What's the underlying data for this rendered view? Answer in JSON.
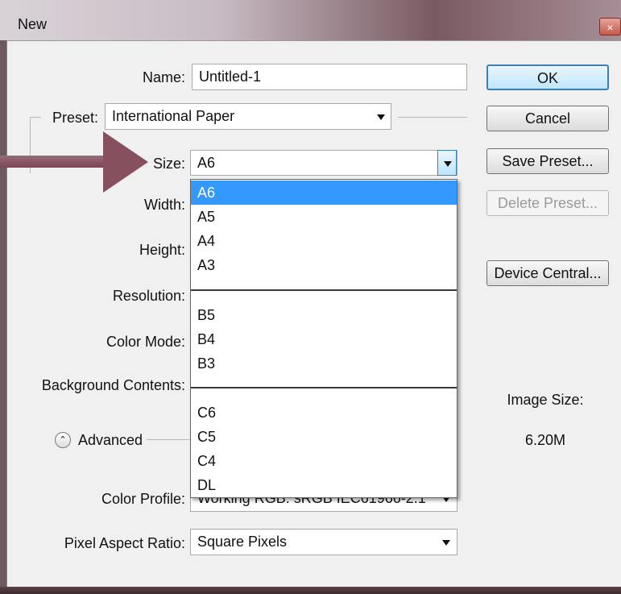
{
  "window": {
    "title": "New",
    "close_glyph": "×"
  },
  "form": {
    "name_label": "Name:",
    "name_value": "Untitled-1",
    "preset_label": "Preset:",
    "preset_value": "International Paper",
    "size_label": "Size:",
    "size_value": "A6",
    "width_label": "Width:",
    "height_label": "Height:",
    "resolution_label": "Resolution:",
    "color_mode_label": "Color Mode:",
    "background_label": "Background Contents:",
    "advanced_label": "Advanced",
    "color_profile_label": "Color Profile:",
    "color_profile_value": "Working RGB:  sRGB IEC61966-2.1",
    "pixel_aspect_label": "Pixel Aspect Ratio:",
    "pixel_aspect_value": "Square Pixels"
  },
  "buttons": {
    "ok": "OK",
    "cancel": "Cancel",
    "save_preset": "Save Preset...",
    "delete_preset": "Delete Preset...",
    "device_central": "Device Central..."
  },
  "image_size": {
    "label": "Image Size:",
    "value": "6.20M"
  },
  "size_dropdown": {
    "selected": "A6",
    "groups": [
      [
        "A6",
        "A5",
        "A4",
        "A3"
      ],
      [
        "B5",
        "B4",
        "B3"
      ],
      [
        "C6",
        "C5",
        "C4",
        "DL"
      ]
    ]
  },
  "colors": {
    "selection": "#3399ff",
    "arrow": "#86505f",
    "default_button": "#3c7fb1"
  },
  "icons": {
    "advanced_toggle": "double-chevron-up-icon",
    "annotation": "arrow-right-icon"
  }
}
